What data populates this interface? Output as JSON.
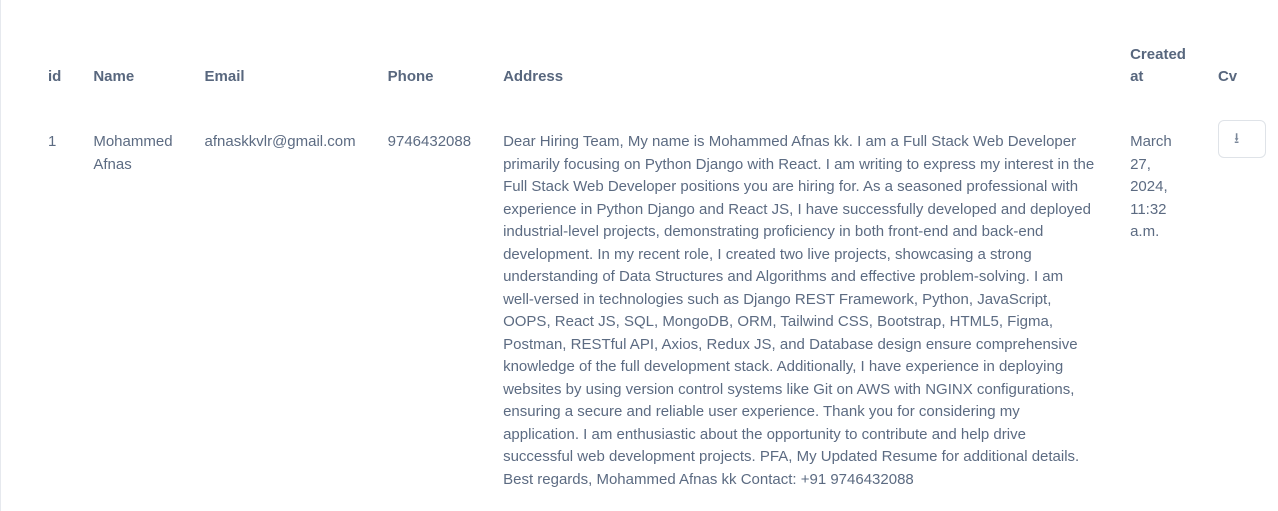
{
  "table": {
    "headers": {
      "id": "id",
      "name": "Name",
      "email": "Email",
      "phone": "Phone",
      "address": "Address",
      "created": "Created at",
      "cv": "Cv"
    },
    "rows": [
      {
        "id": "1",
        "name": "Mohammed Afnas",
        "email": "afnaskkvlr@gmail.com",
        "phone": "9746432088",
        "address": "Dear Hiring Team, My name is Mohammed Afnas kk. I am a Full Stack Web Developer primarily focusing on Python Django with React. I am writing to express my interest in the Full Stack Web Developer positions you are hiring for. As a seasoned professional with experience in Python Django and React JS, I have successfully developed and deployed industrial-level projects, demonstrating proficiency in both front-end and back-end development. In my recent role, I created two live projects, showcasing a strong understanding of Data Structures and Algorithms and effective problem-solving. I am well-versed in technologies such as Django REST Framework, Python, JavaScript, OOPS, React JS, SQL, MongoDB, ORM, Tailwind CSS, Bootstrap, HTML5, Figma, Postman, RESTful API, Axios, Redux JS, and Database design ensure comprehensive knowledge of the full development stack. Additionally, I have experience in deploying websites by using version control systems like Git on AWS with NGINX configurations, ensuring a secure and reliable user experience. Thank you for considering my application. I am enthusiastic about the opportunity to contribute and help drive successful web development projects. PFA, My Updated Resume for additional details. Best regards, Mohammed Afnas kk Contact: +91 9746432088",
        "created": "March 27, 2024, 11:32 a.m.",
        "cv_icon": "download-icon"
      }
    ]
  }
}
